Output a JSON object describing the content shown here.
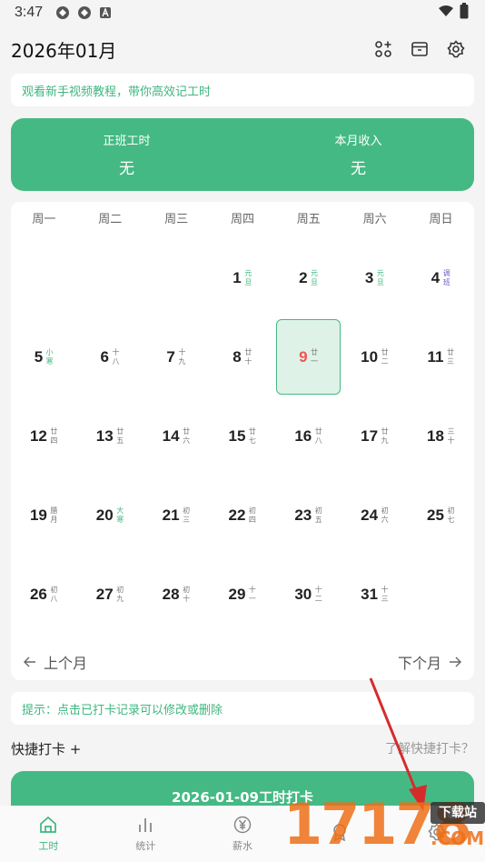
{
  "status_bar": {
    "time": "3:47"
  },
  "header": {
    "title": "2026年01月"
  },
  "tutorial": {
    "text": "观看新手视频教程，带你高效记工时"
  },
  "summary": {
    "overtime_label": "正班工时",
    "overtime_value": "无",
    "income_label": "本月收入",
    "income_value": "无"
  },
  "calendar": {
    "weekdays": [
      "周一",
      "周二",
      "周三",
      "周四",
      "周五",
      "周六",
      "周日"
    ],
    "today": 9,
    "weeks": [
      [
        null,
        null,
        null,
        {
          "day": "1",
          "lunar": "元旦",
          "kind": "holiday"
        },
        {
          "day": "2",
          "lunar": "元旦",
          "kind": "holiday"
        },
        {
          "day": "3",
          "lunar": "元旦",
          "kind": "holiday"
        },
        {
          "day": "4",
          "lunar": "调班",
          "kind": "workday"
        }
      ],
      [
        {
          "day": "5",
          "lunar": "小寒",
          "kind": "term"
        },
        {
          "day": "6",
          "lunar": "十八",
          "kind": "normal"
        },
        {
          "day": "7",
          "lunar": "十九",
          "kind": "normal"
        },
        {
          "day": "8",
          "lunar": "廿十",
          "kind": "normal"
        },
        {
          "day": "9",
          "lunar": "廿一",
          "kind": "normal"
        },
        {
          "day": "10",
          "lunar": "廿二",
          "kind": "normal"
        },
        {
          "day": "11",
          "lunar": "廿三",
          "kind": "normal"
        }
      ],
      [
        {
          "day": "12",
          "lunar": "廿四",
          "kind": "normal"
        },
        {
          "day": "13",
          "lunar": "廿五",
          "kind": "normal"
        },
        {
          "day": "14",
          "lunar": "廿六",
          "kind": "normal"
        },
        {
          "day": "15",
          "lunar": "廿七",
          "kind": "normal"
        },
        {
          "day": "16",
          "lunar": "廿八",
          "kind": "normal"
        },
        {
          "day": "17",
          "lunar": "廿九",
          "kind": "normal"
        },
        {
          "day": "18",
          "lunar": "三十",
          "kind": "normal"
        }
      ],
      [
        {
          "day": "19",
          "lunar": "腊月",
          "kind": "normal"
        },
        {
          "day": "20",
          "lunar": "大寒",
          "kind": "term"
        },
        {
          "day": "21",
          "lunar": "初三",
          "kind": "normal"
        },
        {
          "day": "22",
          "lunar": "初四",
          "kind": "normal"
        },
        {
          "day": "23",
          "lunar": "初五",
          "kind": "normal"
        },
        {
          "day": "24",
          "lunar": "初六",
          "kind": "normal"
        },
        {
          "day": "25",
          "lunar": "初七",
          "kind": "normal"
        }
      ],
      [
        {
          "day": "26",
          "lunar": "初八",
          "kind": "normal"
        },
        {
          "day": "27",
          "lunar": "初九",
          "kind": "normal"
        },
        {
          "day": "28",
          "lunar": "初十",
          "kind": "normal"
        },
        {
          "day": "29",
          "lunar": "十一",
          "kind": "normal"
        },
        {
          "day": "30",
          "lunar": "十二",
          "kind": "normal"
        },
        {
          "day": "31",
          "lunar": "十三",
          "kind": "normal"
        },
        null
      ]
    ],
    "prev_label": "上个月",
    "next_label": "下个月"
  },
  "tip": {
    "text": "提示：点击已打卡记录可以修改或删除"
  },
  "quick": {
    "label": "快捷打卡 +",
    "help": "了解快捷打卡？"
  },
  "punch_button": {
    "label": "2026-01-09工时打卡"
  },
  "tabs": [
    {
      "label": "工时",
      "icon": "home-icon",
      "active": true
    },
    {
      "label": "统计",
      "icon": "bar-chart-icon",
      "active": false
    },
    {
      "label": "薪水",
      "icon": "yuan-icon",
      "active": false
    },
    {
      "label": "",
      "icon": "reward-icon",
      "active": false
    },
    {
      "label": "",
      "icon": "settings-icon",
      "active": false
    }
  ],
  "watermark": {
    "number": "17178",
    "badge": "下载站",
    "domain": ".COM"
  },
  "colors": {
    "accent": "#45b984",
    "today_text": "#e55555",
    "workday": "#6a5cc7",
    "arrow": "#d62b2b",
    "watermark": "#ec6e18"
  }
}
